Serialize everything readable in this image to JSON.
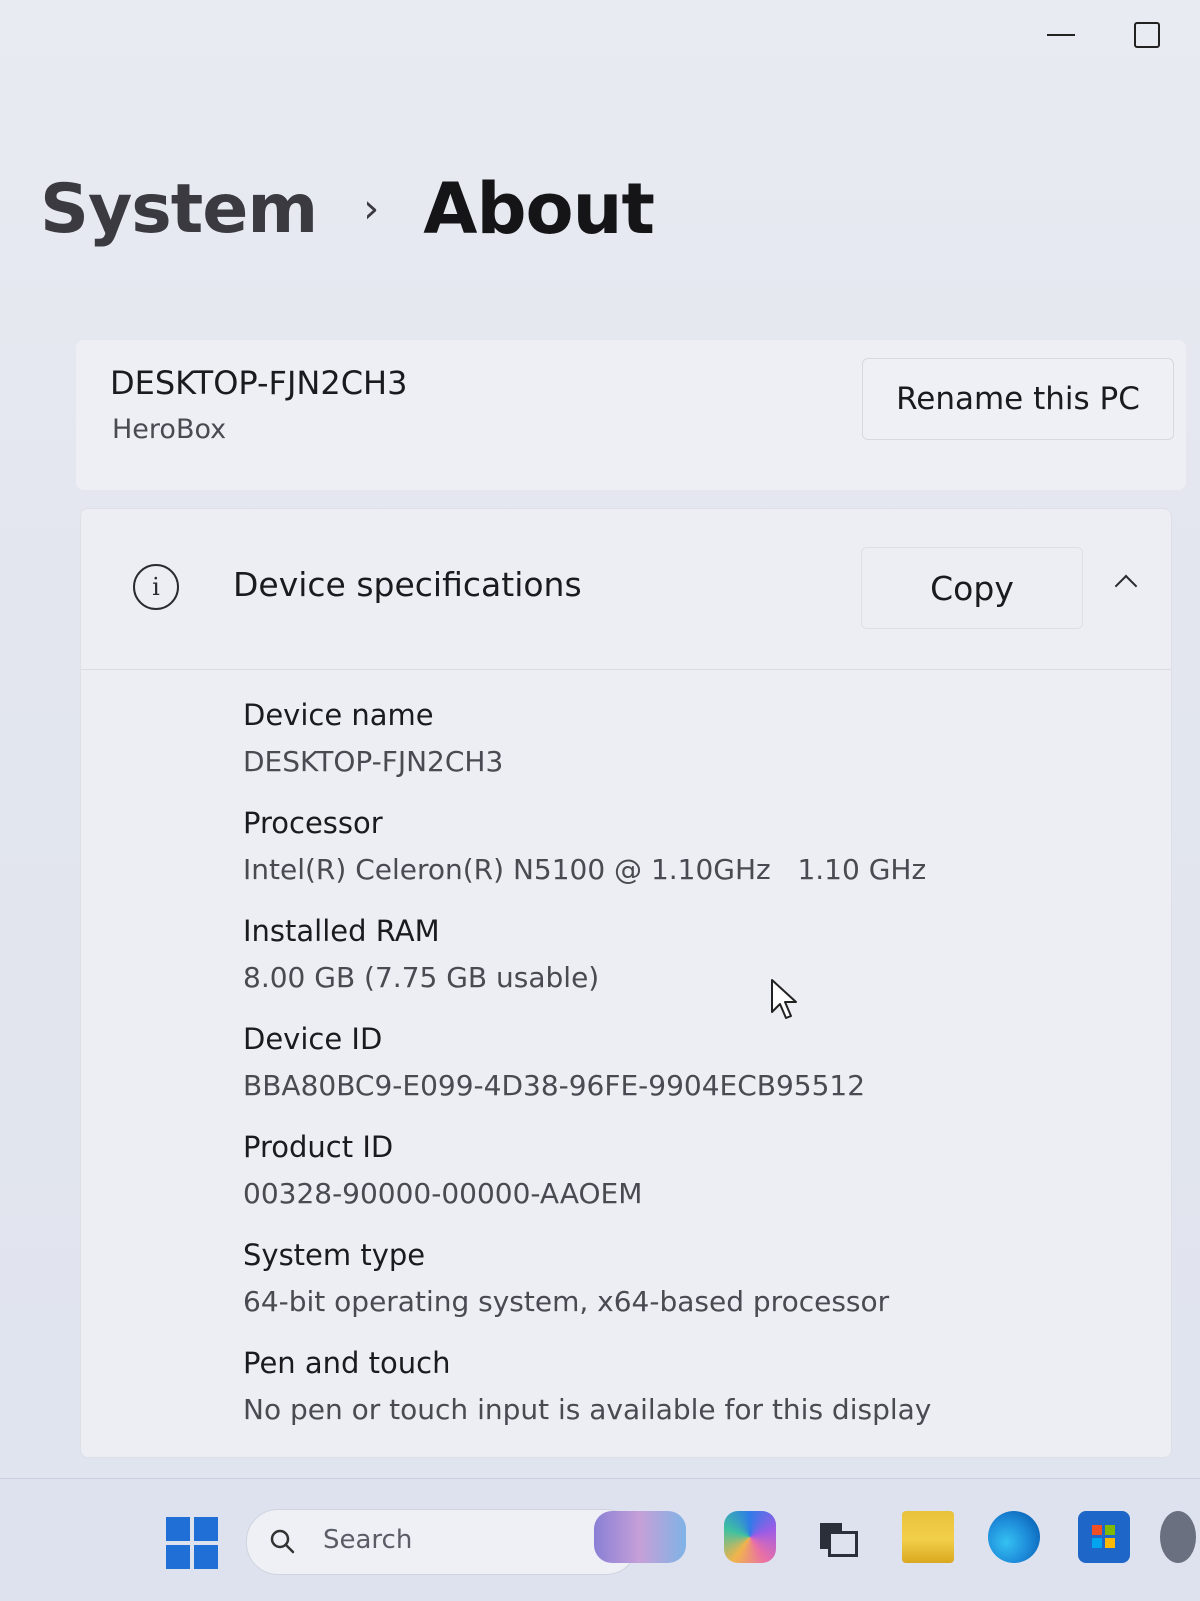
{
  "breadcrumb": {
    "parent": "System",
    "separator": "›",
    "current": "About"
  },
  "pc": {
    "name": "DESKTOP-FJN2CH3",
    "model": "HeroBox",
    "rename_label": "Rename this PC"
  },
  "device_specs": {
    "title": "Device specifications",
    "info_glyph": "i",
    "copy_label": "Copy",
    "rows": [
      {
        "label": "Device name",
        "value": "DESKTOP-FJN2CH3"
      },
      {
        "label": "Processor",
        "value": "Intel(R) Celeron(R) N5100 @ 1.10GHz   1.10 GHz"
      },
      {
        "label": "Installed RAM",
        "value": "8.00 GB (7.75 GB usable)"
      },
      {
        "label": "Device ID",
        "value": "BBA80BC9-E099-4D38-96FE-9904ECB95512"
      },
      {
        "label": "Product ID",
        "value": "00328-90000-00000-AAOEM"
      },
      {
        "label": "System type",
        "value": "64-bit operating system, x64-based processor"
      },
      {
        "label": "Pen and touch",
        "value": "No pen or touch input is available for this display"
      }
    ]
  },
  "taskbar": {
    "search_placeholder": "Search",
    "icons": [
      "start-icon",
      "widgets-icon",
      "copilot-icon",
      "task-view-icon",
      "file-explorer-icon",
      "edge-icon",
      "store-icon",
      "settings-icon"
    ]
  },
  "colors": {
    "accent": "#1f6fd6",
    "window_bg": "#e6e9f1",
    "card_bg": "#eceef3"
  }
}
